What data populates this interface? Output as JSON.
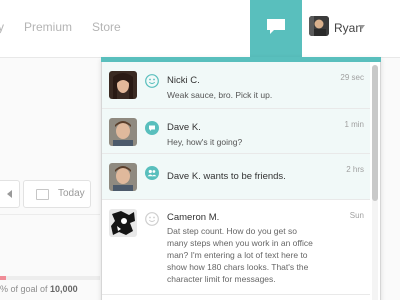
{
  "nav": {
    "links": [
      {
        "label": "y"
      },
      {
        "label": "Premium"
      },
      {
        "label": "Store"
      }
    ],
    "user_name": "Ryan"
  },
  "background": {
    "today_label": "Today",
    "goal_prefix": "% of goal of ",
    "goal_value": "10,000"
  },
  "notifications": {
    "items": [
      {
        "name": "Nicki C.",
        "message": "Weak sauce, bro. Pick it up.",
        "time": "29 sec",
        "icon": "smiley-icon"
      },
      {
        "name": "Dave K.",
        "message": "Hey, how's it going?",
        "time": "1 min",
        "icon": "chat-bubble-icon"
      },
      {
        "name": "Dave K. wants to be friends.",
        "message": "",
        "time": "2 hrs",
        "icon": "friends-icon"
      },
      {
        "name": "Cameron M.",
        "message": "Dat step count. How do you get so many steps when you work in an office man? I'm entering a lot of text here to show how 180 chars looks. That's the character limit for messages.",
        "time": "Sun",
        "icon": "smiley-outline-icon"
      }
    ]
  },
  "colors": {
    "accent": "#59bfbd",
    "active_row": "#f1f9f8",
    "progress": "#f08c97"
  }
}
